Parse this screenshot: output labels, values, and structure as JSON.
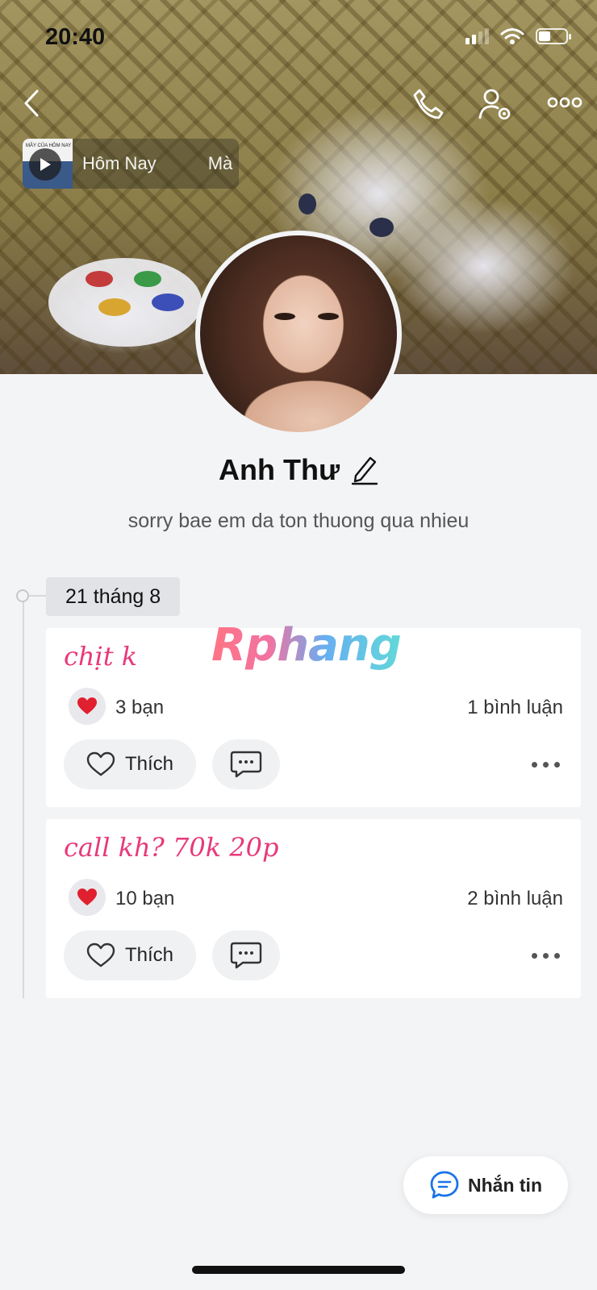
{
  "status_bar": {
    "time": "20:40"
  },
  "header": {
    "back_icon": "chevron-left-icon",
    "call_icon": "phone-icon",
    "settings_icon": "user-settings-icon",
    "more_icon": "more-horizontal-icon"
  },
  "music": {
    "thumb_caption": "MÂY CỦA HÔM NAY",
    "text": "Hôm Nay",
    "text_next": "Mà"
  },
  "profile": {
    "name": "Anh Thư",
    "bio": "sorry bae em da ton thuong qua nhieu"
  },
  "timeline": {
    "date": "21 tháng 8",
    "posts": [
      {
        "text": "chịt k",
        "reactions": "3 bạn",
        "comments": "1 bình luận",
        "like_label": "Thích"
      },
      {
        "text": "call kh? 70k 20p",
        "reactions": "10 bạn",
        "comments": "2 bình luận",
        "like_label": "Thích"
      }
    ]
  },
  "watermark": "Rphang",
  "fab": {
    "label": "Nhắn tin"
  },
  "colors": {
    "post_text": "#e8397a",
    "background": "#f3f4f6",
    "fab_icon": "#1a73e8"
  }
}
